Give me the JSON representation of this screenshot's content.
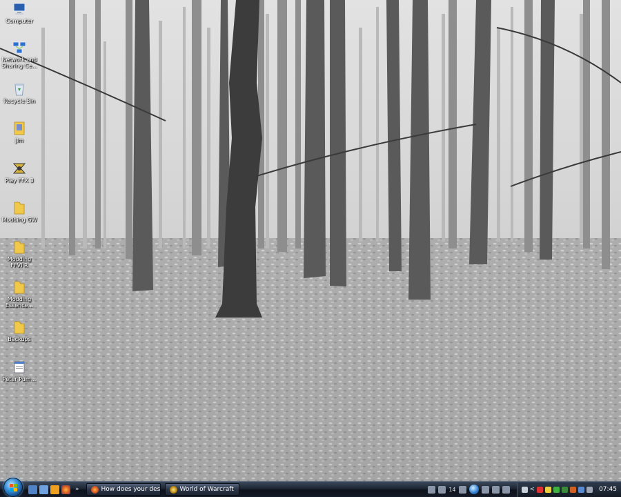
{
  "desktop_icons": [
    {
      "name": "computer",
      "label": "Computer",
      "glyph": "computer-icon"
    },
    {
      "name": "network",
      "label": "Network and Sharing Ce...",
      "glyph": "network-icon"
    },
    {
      "name": "recycle-bin",
      "label": "Recycle Bin",
      "glyph": "recycle-bin-icon"
    },
    {
      "name": "jim",
      "label": "Jim",
      "glyph": "user-folder-icon"
    },
    {
      "name": "play-ffx3",
      "label": "Play FFX 3",
      "glyph": "ffx-icon"
    },
    {
      "name": "modding-gw",
      "label": "Modding GW",
      "glyph": "folder-icon"
    },
    {
      "name": "modding-ffvi",
      "label": "Modding FFVI R",
      "glyph": "folder-icon"
    },
    {
      "name": "modding-essence",
      "label": "Modding Essence...",
      "glyph": "folder-icon"
    },
    {
      "name": "backups",
      "label": "Backups",
      "glyph": "folder-icon"
    },
    {
      "name": "peter-pum",
      "label": "Peter Pum...",
      "glyph": "document-icon"
    }
  ],
  "taskbar": {
    "start_icon": "windows-start-orb-icon",
    "quick_launch": [
      "show-desktop-icon",
      "switch-windows-icon",
      "media-player-icon",
      "firefox-icon"
    ],
    "quick_launch_more": "»",
    "tasks": [
      {
        "label": "How does your desk...",
        "icon": "firefox-icon"
      },
      {
        "label": "World of Warcraft",
        "icon": "wow-icon"
      }
    ],
    "media_time": "14",
    "tray_expand": "<",
    "clock": "07:45"
  },
  "colors": {
    "taskbar": "#151b27",
    "start_orb": "#3a8fd8",
    "folder": "#f0c84a"
  }
}
